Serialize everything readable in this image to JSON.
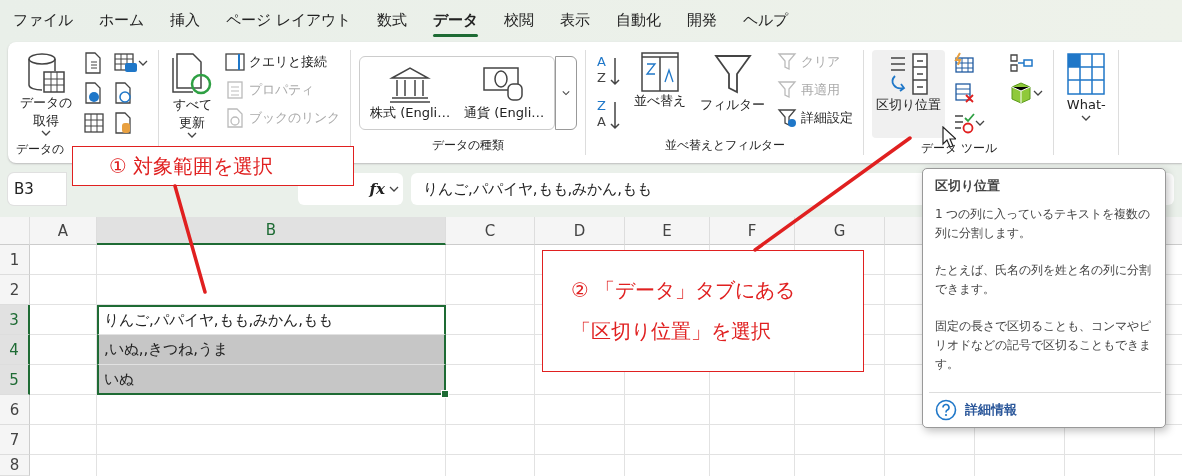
{
  "menu_tabs": [
    {
      "label": "ファイル",
      "selected": false
    },
    {
      "label": "ホーム",
      "selected": false
    },
    {
      "label": "挿入",
      "selected": false
    },
    {
      "label": "ページ レイアウト",
      "selected": false
    },
    {
      "label": "数式",
      "selected": false
    },
    {
      "label": "データ",
      "selected": true
    },
    {
      "label": "校閲",
      "selected": false
    },
    {
      "label": "表示",
      "selected": false
    },
    {
      "label": "自動化",
      "selected": false
    },
    {
      "label": "開発",
      "selected": false
    },
    {
      "label": "ヘルプ",
      "selected": false
    }
  ],
  "ribbon": {
    "groups": [
      {
        "kind": "get_data",
        "label": "データの",
        "items": [
          {
            "kind": "large",
            "lines": [
              "データの",
              "取得"
            ],
            "caret": true
          }
        ]
      },
      {
        "kind": "queries",
        "items": [
          {
            "kind": "large",
            "lines": [
              "すべて",
              "更新"
            ],
            "caret": true
          },
          {
            "kind": "small",
            "label": "クエリと接続",
            "disabled": false
          },
          {
            "kind": "small",
            "label": "プロパティ",
            "disabled": true
          },
          {
            "kind": "small",
            "label": "ブックのリンク",
            "disabled": true
          }
        ]
      },
      {
        "kind": "data_types",
        "label": "データの種類",
        "items": [
          {
            "kind": "gallery",
            "label": "株式 (Engli…"
          },
          {
            "kind": "gallery",
            "label": "通貨 (Engli…"
          }
        ]
      },
      {
        "kind": "sort_filter",
        "label": "並べ替えとフィルター",
        "items": [
          {
            "kind": "sort_order",
            "letters": [
              "A",
              "Z"
            ]
          },
          {
            "kind": "sort_order",
            "letters": [
              "Z",
              "A"
            ]
          },
          {
            "kind": "large",
            "lines": [
              "並べ替え"
            ],
            "caret": false
          },
          {
            "kind": "large",
            "lines": [
              "フィルター"
            ],
            "caret": false
          },
          {
            "kind": "small",
            "label": "クリア",
            "disabled": true
          },
          {
            "kind": "small",
            "label": "再適用",
            "disabled": true
          },
          {
            "kind": "small",
            "label": "詳細設定",
            "disabled": false
          }
        ]
      },
      {
        "kind": "data_tools",
        "label": "データ ツール",
        "items": [
          {
            "kind": "large",
            "lines": [
              "区切り位置"
            ],
            "caret": false,
            "hovered": true
          }
        ]
      },
      {
        "kind": "forecast",
        "items": [
          {
            "kind": "large",
            "lines": [
              "What-"
            ],
            "caret": true
          }
        ]
      }
    ]
  },
  "formula_bar": {
    "name_box": "B3",
    "function_label": "fx",
    "formula": "りんご,パパイヤ,もも,みかん,もも"
  },
  "sheet": {
    "columns": [
      {
        "label": "A",
        "selected": false
      },
      {
        "label": "B",
        "selected": true
      },
      {
        "label": "C",
        "selected": false
      },
      {
        "label": "D",
        "selected": false
      },
      {
        "label": "E",
        "selected": false
      },
      {
        "label": "F",
        "selected": false
      },
      {
        "label": "G",
        "selected": false
      }
    ],
    "rows": [
      {
        "label": "1",
        "selected": false
      },
      {
        "label": "2",
        "selected": false
      },
      {
        "label": "3",
        "selected": true,
        "cells": [
          null,
          {
            "value": "りんご,パパイヤ,もも,みかん,もも",
            "selected": true,
            "active": true
          }
        ]
      },
      {
        "label": "4",
        "selected": true,
        "cells": [
          null,
          {
            "value": ",いぬ,,きつね,うま",
            "selected": true,
            "active": false
          }
        ]
      },
      {
        "label": "5",
        "selected": true,
        "cells": [
          null,
          {
            "value": "いぬ",
            "selected": true,
            "active": false
          }
        ]
      },
      {
        "label": "6",
        "selected": false
      },
      {
        "label": "7",
        "selected": false
      },
      {
        "label": "8",
        "selected": false
      }
    ]
  },
  "callouts": [
    {
      "lines": [
        "① 対象範囲を選択"
      ]
    },
    {
      "lines": [
        "② 「データ」タブにある",
        "「区切り位置」を選択"
      ]
    }
  ],
  "tooltip": {
    "title": "区切り位置",
    "paragraphs": [
      "1 つの列に入っているテキストを複数の列に分割します。",
      "たとえば、氏名の列を姓と名の列に分割できます。",
      "固定の長さで区切ることも、コンマやピリオドなどの記号で区切ることもできます。"
    ],
    "link": "詳細情報"
  }
}
